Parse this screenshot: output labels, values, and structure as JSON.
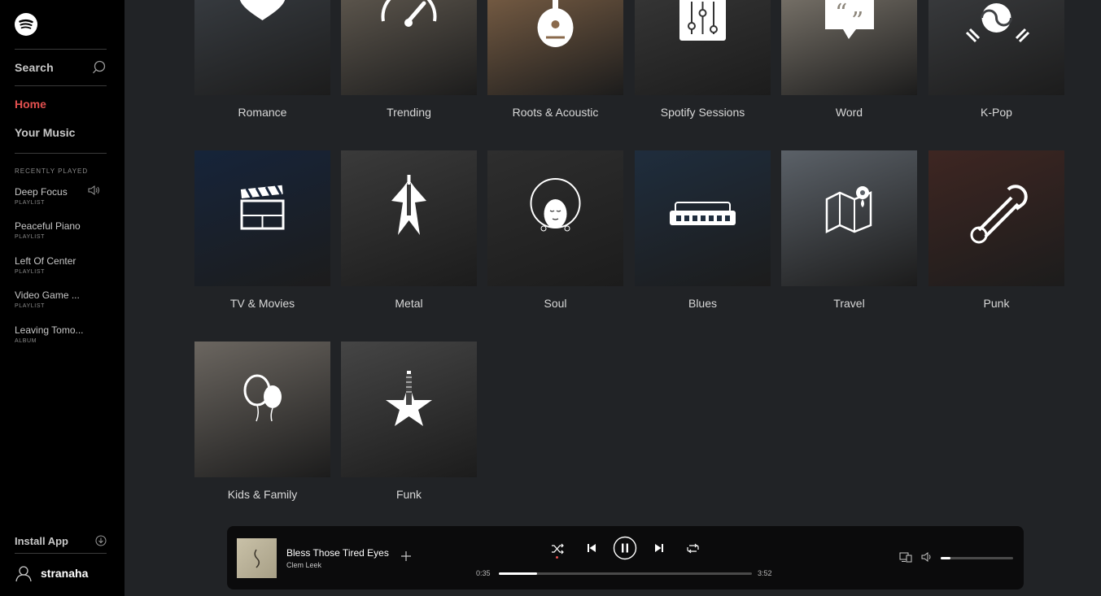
{
  "sidebar": {
    "search_label": "Search",
    "nav": {
      "home": "Home",
      "your_music": "Your Music"
    },
    "recently_played_heading": "RECENTLY PLAYED",
    "recent": [
      {
        "title": "Deep Focus",
        "type": "PLAYLIST"
      },
      {
        "title": "Peaceful Piano",
        "type": "PLAYLIST"
      },
      {
        "title": "Left Of Center",
        "type": "PLAYLIST"
      },
      {
        "title": "Video Game ...",
        "type": "PLAYLIST"
      },
      {
        "title": "Leaving Tomo...",
        "type": "ALBUM"
      }
    ],
    "install_label": "Install App",
    "username": "stranaha"
  },
  "genres": [
    {
      "label": "Romance",
      "icon": "heart-icon",
      "color": "#3d4248"
    },
    {
      "label": "Trending",
      "icon": "speedometer-icon",
      "color": "#6b6358"
    },
    {
      "label": "Roots & Acoustic",
      "icon": "mandolin-icon",
      "color": "#8a6a4c"
    },
    {
      "label": "Spotify Sessions",
      "icon": "mixer-icon",
      "color": "#3b3b3b"
    },
    {
      "label": "Word",
      "icon": "quote-bubble-icon",
      "color": "#8c857a"
    },
    {
      "label": "K-Pop",
      "icon": "korean-flag-icon",
      "color": "#3f4144"
    },
    {
      "label": "TV & Movies",
      "icon": "clapperboard-icon",
      "color": "#16243a"
    },
    {
      "label": "Metal",
      "icon": "guitar-icon",
      "color": "#3a3a3a"
    },
    {
      "label": "Soul",
      "icon": "afro-face-icon",
      "color": "#2e2e2e"
    },
    {
      "label": "Blues",
      "icon": "harmonica-icon",
      "color": "#1f2d3d"
    },
    {
      "label": "Travel",
      "icon": "map-pin-icon",
      "color": "#5b6168"
    },
    {
      "label": "Punk",
      "icon": "safety-pin-icon",
      "color": "#3e2622"
    },
    {
      "label": "Kids & Family",
      "icon": "balloons-icon",
      "color": "#6b6660"
    },
    {
      "label": "Funk",
      "icon": "star-guitar-icon",
      "color": "#454545"
    }
  ],
  "player": {
    "track_title": "Bless Those Tired Eyes",
    "artist": "Clem Leek",
    "elapsed": "0:35",
    "duration": "3:52",
    "progress": 0.15,
    "volume": 0.14
  },
  "colors": {
    "accent": "#e3504f",
    "background": "#212326",
    "sidebar": "#000000"
  }
}
